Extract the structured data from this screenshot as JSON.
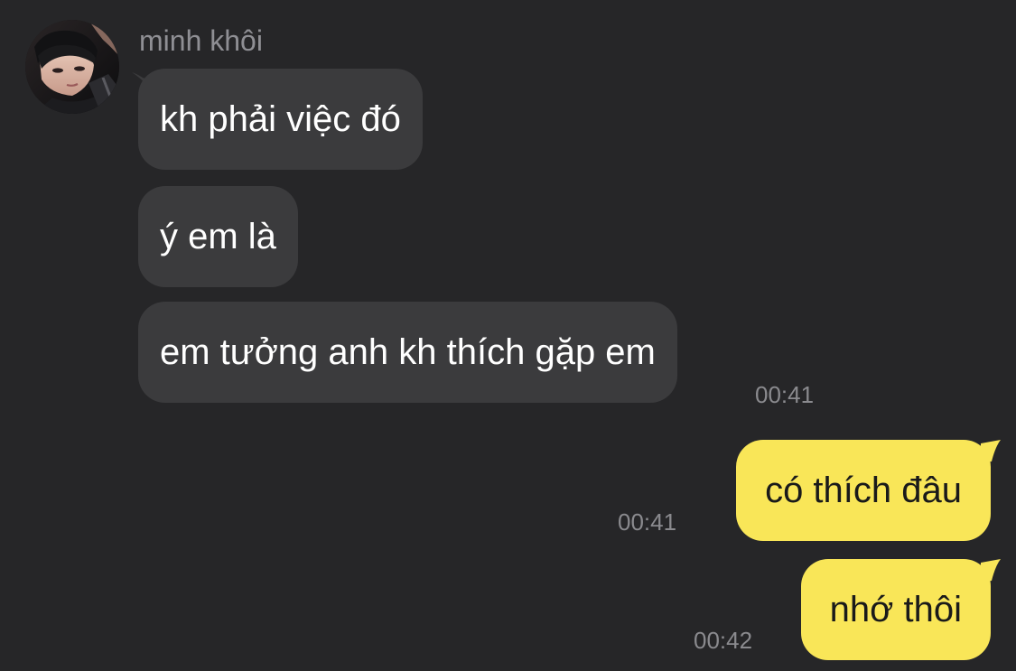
{
  "conversation": {
    "sender_name": "minh khôi",
    "incoming": [
      {
        "text": "kh phải việc đó"
      },
      {
        "text": "ý em là"
      },
      {
        "text": "em tưởng anh kh thích gặp em",
        "time": "00:41"
      }
    ],
    "outgoing": [
      {
        "text": "có thích đâu",
        "time": "00:41"
      },
      {
        "text": "nhớ thôi",
        "time": "00:42"
      }
    ]
  },
  "colors": {
    "background": "#262628",
    "incoming_bubble": "#3b3b3d",
    "outgoing_bubble": "#f9e658",
    "timestamp": "#8a8a8e",
    "sender_name": "#8f8f94"
  },
  "icons": {
    "avatar": "user-photo-avatar"
  }
}
